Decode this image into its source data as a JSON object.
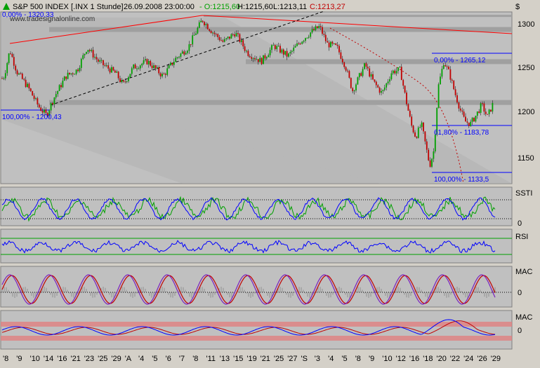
{
  "header": {
    "symbol": "S&P 500 INDEX [.INX  1 Stunde]",
    "datetime": "26.09.2008 23:00:00",
    "open": "- O:1215,60",
    "high": "H:1215,60",
    "low": "L:1213,11",
    "close": "C:1213,27",
    "currency": "$"
  },
  "watermark": "www.tradesignalonline.com",
  "chart_data": [
    {
      "type": "candlestick",
      "name": "price",
      "ylim": [
        1122,
        1318
      ],
      "yticks": [
        1300,
        1250,
        1200,
        1150
      ],
      "ytick_labels": [
        "1300",
        "1250",
        "1200",
        "1150"
      ],
      "path": [
        [
          0,
          1240
        ],
        [
          6,
          1245
        ],
        [
          14,
          1275
        ],
        [
          24,
          1250
        ],
        [
          40,
          1232
        ],
        [
          55,
          1210
        ],
        [
          66,
          1200
        ],
        [
          78,
          1222
        ],
        [
          94,
          1245
        ],
        [
          110,
          1252
        ],
        [
          124,
          1278
        ],
        [
          140,
          1262
        ],
        [
          165,
          1248
        ],
        [
          175,
          1235
        ],
        [
          190,
          1255
        ],
        [
          210,
          1262
        ],
        [
          232,
          1245
        ],
        [
          250,
          1265
        ],
        [
          268,
          1278
        ],
        [
          288,
          1310
        ],
        [
          300,
          1298
        ],
        [
          318,
          1284
        ],
        [
          335,
          1295
        ],
        [
          352,
          1272
        ],
        [
          372,
          1262
        ],
        [
          390,
          1280
        ],
        [
          410,
          1268
        ],
        [
          428,
          1285
        ],
        [
          442,
          1295
        ],
        [
          455,
          1302
        ],
        [
          466,
          1282
        ],
        [
          480,
          1278
        ],
        [
          492,
          1256
        ],
        [
          502,
          1228
        ],
        [
          512,
          1245
        ],
        [
          520,
          1258
        ],
        [
          532,
          1238
        ],
        [
          544,
          1225
        ],
        [
          558,
          1250
        ],
        [
          570,
          1252
        ],
        [
          578,
          1218
        ],
        [
          586,
          1188
        ],
        [
          592,
          1175
        ],
        [
          600,
          1190
        ],
        [
          607,
          1162
        ],
        [
          612,
          1142
        ],
        [
          618,
          1160
        ],
        [
          624,
          1232
        ],
        [
          632,
          1262
        ],
        [
          640,
          1248
        ],
        [
          648,
          1225
        ],
        [
          656,
          1205
        ],
        [
          662,
          1193
        ],
        [
          670,
          1190
        ],
        [
          678,
          1200
        ],
        [
          686,
          1212
        ],
        [
          694,
          1198
        ],
        [
          702,
          1213
        ]
      ],
      "levels": [
        {
          "label": "100,00% - 1200,43",
          "value": 1200.43
        },
        {
          "label": "0,00% - 1265,12",
          "value": 1265.12
        },
        {
          "label": "61,80% - 1183,78",
          "value": 1183.78
        },
        {
          "label": "100,00% - 1133,5",
          "value": 1133.5
        },
        {
          "label": "0,00% - 1320,33",
          "value": 1320.33
        }
      ],
      "horizontal_bands": [
        1313,
        1299,
        1262,
        1215
      ],
      "x_tick_labels": [
        "8",
        "9",
        "10",
        "14",
        "16",
        "21",
        "23",
        "25",
        "29",
        "A",
        "4",
        "5",
        "6",
        "7",
        "8",
        "11",
        "13",
        "15",
        "19",
        "21",
        "25",
        "27",
        "S",
        "3",
        "4",
        "5",
        "8",
        "9",
        "10",
        "12",
        "16",
        "18",
        "20",
        "22",
        "24",
        "26",
        "29"
      ]
    },
    {
      "type": "line",
      "name": "SSTI",
      "ylim": [
        0,
        100
      ],
      "ytick_labels": [
        "0"
      ]
    },
    {
      "type": "line",
      "name": "RSI",
      "ylim": [
        0,
        100
      ]
    },
    {
      "type": "line",
      "name": "MAC",
      "ytick_labels": [
        "0"
      ]
    },
    {
      "type": "line",
      "name": "MAC",
      "ytick_labels": [
        "0"
      ]
    }
  ],
  "colors": {
    "up": "#00a000",
    "down": "#c00000",
    "trend": "#ff0000",
    "fib": "#0000ff",
    "panel_bg": "#c0c0c0",
    "band": "#a0a0a0",
    "osc_blue": "#0000ff",
    "osc_green": "#00a000",
    "osc_purple": "#a020a0",
    "pink_band": "#e09090"
  },
  "icons": [
    "price-up-icon"
  ]
}
